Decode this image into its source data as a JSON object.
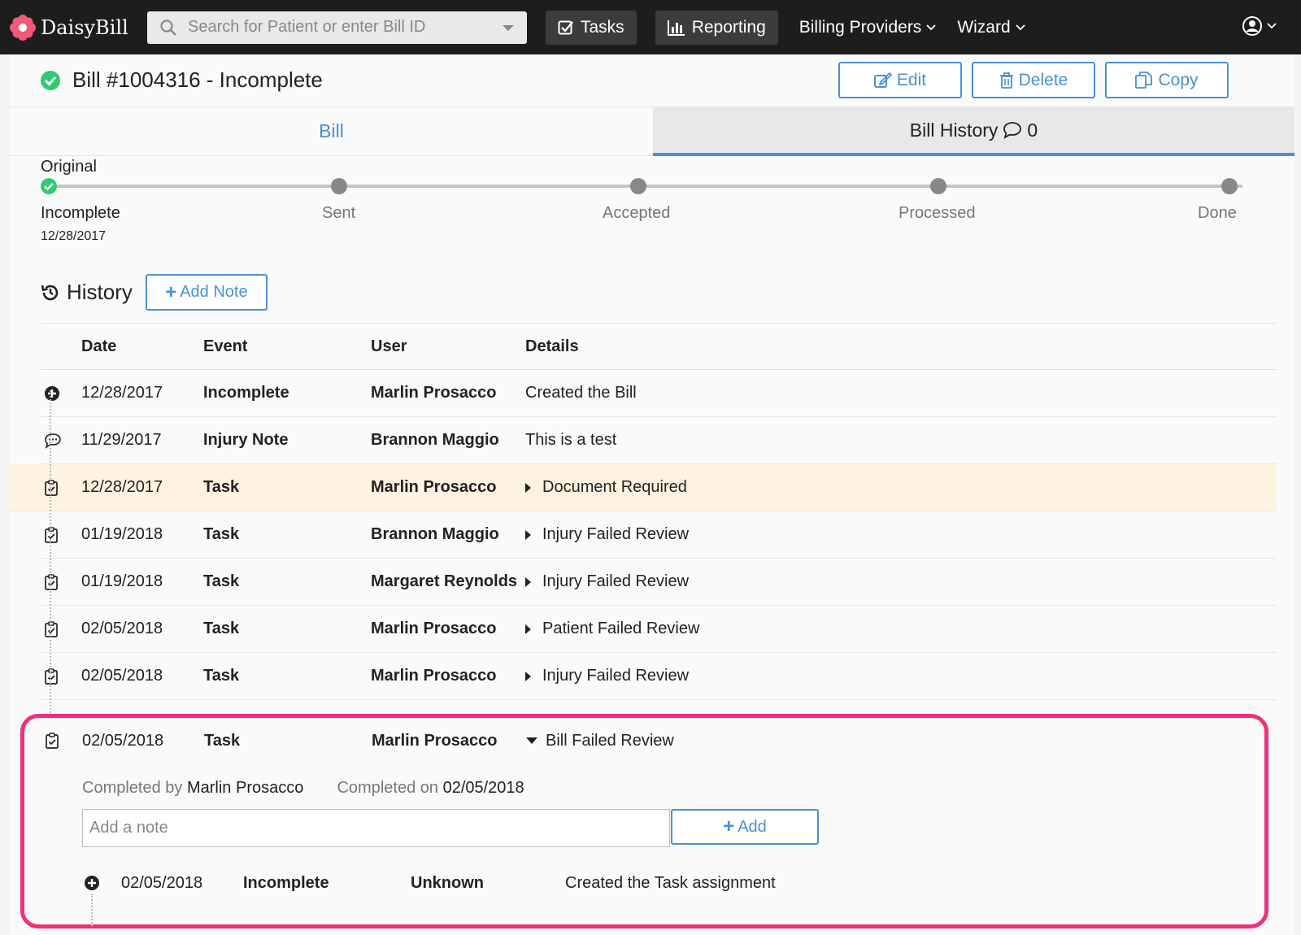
{
  "nav": {
    "brand": "DaisyBill",
    "search_placeholder": "Search for Patient or enter Bill ID",
    "tasks": "Tasks",
    "reporting": "Reporting",
    "billing_providers": "Billing Providers",
    "wizard": "Wizard"
  },
  "bill": {
    "title": "Bill #1004316 - Incomplete",
    "edit": "Edit",
    "delete": "Delete",
    "copy": "Copy"
  },
  "tabs": {
    "bill": "Bill",
    "history": "Bill History",
    "history_count": "0"
  },
  "progress": {
    "label": "Original",
    "steps": [
      "Incomplete",
      "Sent",
      "Accepted",
      "Processed",
      "Done"
    ],
    "current_date": "12/28/2017"
  },
  "history": {
    "title": "History",
    "add_note": "Add Note",
    "columns": [
      "Date",
      "Event",
      "User",
      "Details"
    ],
    "rows": [
      {
        "icon": "plus-circle-icon",
        "date": "12/28/2017",
        "event": "Incomplete",
        "user": "Marlin Prosacco",
        "details": "Created the Bill"
      },
      {
        "icon": "comment-icon",
        "date": "11/29/2017",
        "event": "Injury Note",
        "user": "Brannon Maggio",
        "details": "This is a test"
      },
      {
        "icon": "clipboard-check-icon",
        "date": "12/28/2017",
        "event": "Task",
        "user": "Marlin Prosacco",
        "details": "Document Required"
      },
      {
        "icon": "clipboard-check-icon",
        "date": "01/19/2018",
        "event": "Task",
        "user": "Brannon Maggio",
        "details": "Injury Failed Review"
      },
      {
        "icon": "clipboard-check-icon",
        "date": "01/19/2018",
        "event": "Task",
        "user": "Margaret Reynolds",
        "details": "Injury Failed Review"
      },
      {
        "icon": "clipboard-check-icon",
        "date": "02/05/2018",
        "event": "Task",
        "user": "Marlin Prosacco",
        "details": "Patient Failed Review"
      },
      {
        "icon": "clipboard-check-icon",
        "date": "02/05/2018",
        "event": "Task",
        "user": "Marlin Prosacco",
        "details": "Injury Failed Review"
      }
    ],
    "expanded": {
      "date": "02/05/2018",
      "event": "Task",
      "user": "Marlin Prosacco",
      "details": "Bill Failed Review",
      "completed_by_label": "Completed by",
      "completed_by": "Marlin Prosacco",
      "completed_on_label": "Completed on",
      "completed_on": "02/05/2018",
      "note_placeholder": "Add a note",
      "add": "Add",
      "sub": {
        "date": "02/05/2018",
        "event": "Incomplete",
        "user": "Unknown",
        "details": "Created the Task assignment"
      }
    }
  },
  "colors": {
    "accent": "#4a90d9",
    "highlight": "#fdf3e0",
    "callout": "#f0307a",
    "success": "#2ecc71"
  }
}
